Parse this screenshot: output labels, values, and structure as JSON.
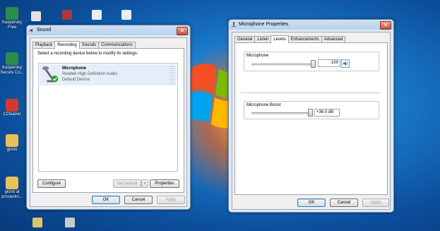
{
  "desktop": {
    "icons": [
      {
        "label": "Kaspersky Free",
        "color": "#2a8d4a"
      },
      {
        "label": "Kaspersky Secure Co...",
        "color": "#2a8d4a"
      },
      {
        "label": "CCleaner",
        "color": "#d33a2c"
      },
      {
        "label": "giorio",
        "color": "#e8c157"
      },
      {
        "label": "giorio al prosentin...",
        "color": "#e8c157"
      }
    ]
  },
  "sound_window": {
    "title": "Sound",
    "tabs": [
      "Playback",
      "Recording",
      "Sounds",
      "Communications"
    ],
    "active_tab": "Recording",
    "instruction": "Select a recording device below to modify its settings:",
    "device": {
      "name": "Microphone",
      "driver": "Realtek High Definition Audio",
      "status": "Default Device"
    },
    "buttons": {
      "configure": "Configure",
      "set_default": "Set Default",
      "properties": "Properties",
      "ok": "OK",
      "cancel": "Cancel",
      "apply": "Apply"
    }
  },
  "mic_window": {
    "title": "Microphone Properties",
    "tabs": [
      "General",
      "Listen",
      "Levels",
      "Enhancements",
      "Advanced"
    ],
    "active_tab": "Levels",
    "microphone": {
      "label": "Microphone",
      "value": "100",
      "level": 1.0
    },
    "boost": {
      "label": "Microphone Boost",
      "value": "+36.0 dB",
      "level": 1.0
    },
    "buttons": {
      "ok": "OK",
      "cancel": "Cancel",
      "apply": "Apply"
    }
  },
  "colors": {
    "accent": "#3c7fb1",
    "close": "#c74b34"
  }
}
